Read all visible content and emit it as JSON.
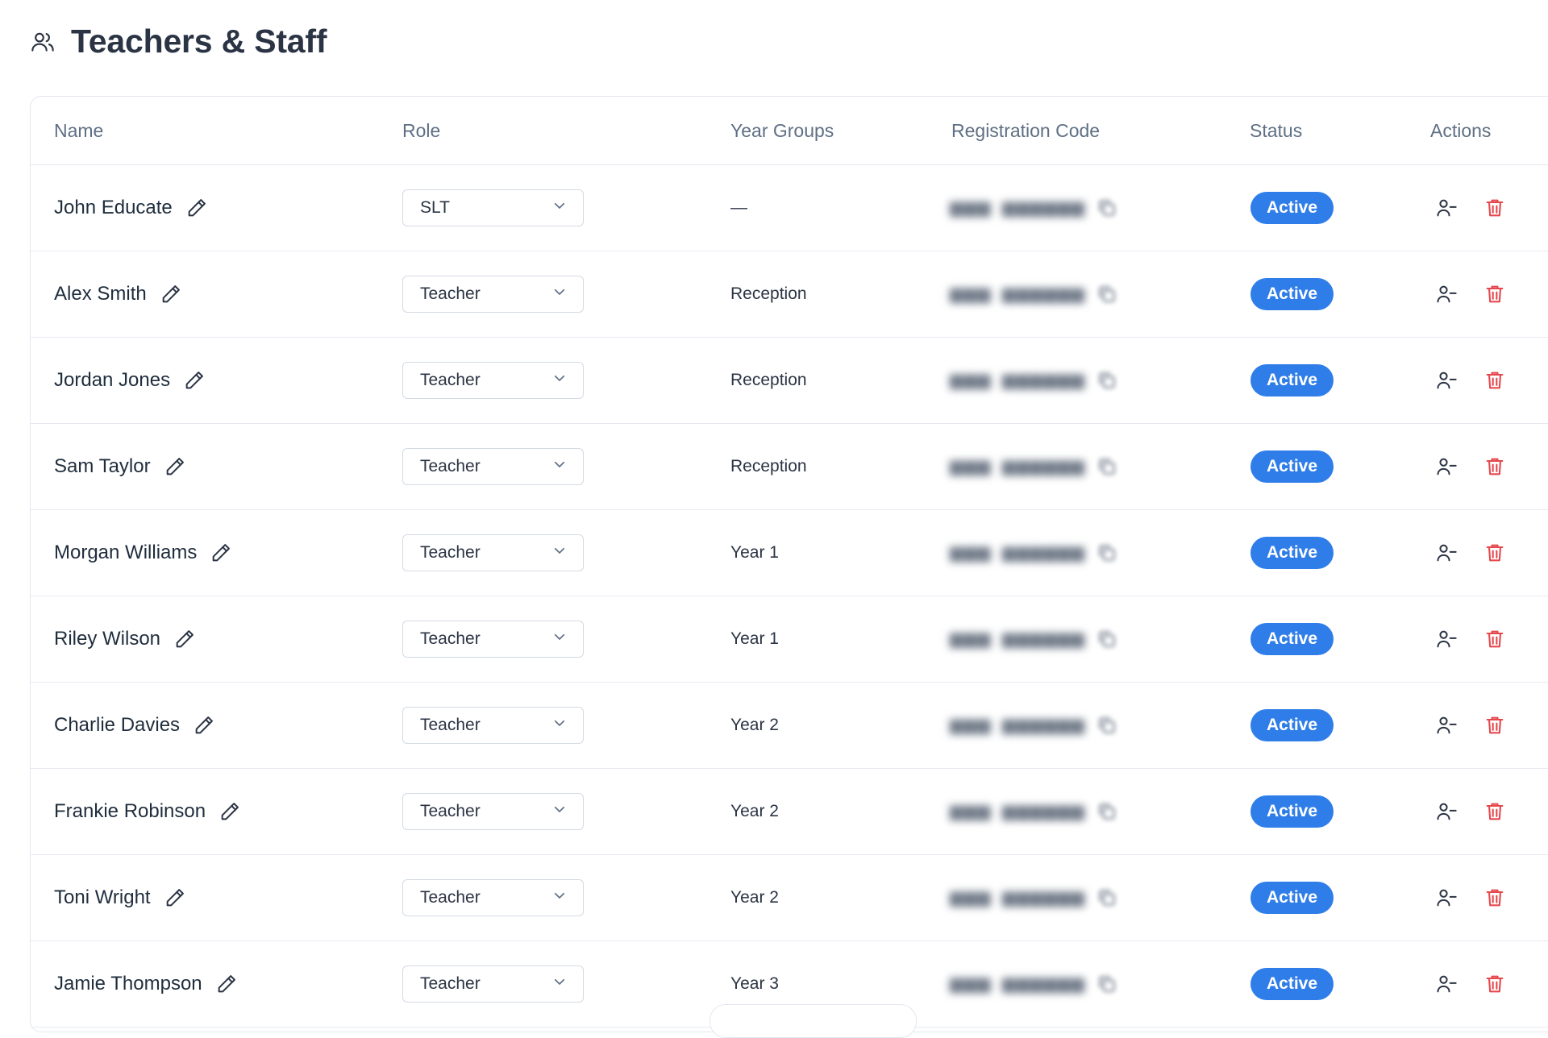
{
  "page": {
    "title": "Teachers & Staff",
    "icon": "users-icon"
  },
  "table": {
    "headers": {
      "name": "Name",
      "role": "Role",
      "year_groups": "Year Groups",
      "registration_code": "Registration Code",
      "status": "Status",
      "actions": "Actions"
    },
    "rows": [
      {
        "name": "John Educate",
        "role": "SLT",
        "year_groups": "—",
        "status": "Active"
      },
      {
        "name": "Alex Smith",
        "role": "Teacher",
        "year_groups": "Reception",
        "status": "Active"
      },
      {
        "name": "Jordan Jones",
        "role": "Teacher",
        "year_groups": "Reception",
        "status": "Active"
      },
      {
        "name": "Sam Taylor",
        "role": "Teacher",
        "year_groups": "Reception",
        "status": "Active"
      },
      {
        "name": "Morgan Williams",
        "role": "Teacher",
        "year_groups": "Year 1",
        "status": "Active"
      },
      {
        "name": "Riley Wilson",
        "role": "Teacher",
        "year_groups": "Year 1",
        "status": "Active"
      },
      {
        "name": "Charlie Davies",
        "role": "Teacher",
        "year_groups": "Year 2",
        "status": "Active"
      },
      {
        "name": "Frankie Robinson",
        "role": "Teacher",
        "year_groups": "Year 2",
        "status": "Active"
      },
      {
        "name": "Toni Wright",
        "role": "Teacher",
        "year_groups": "Year 2",
        "status": "Active"
      },
      {
        "name": "Jamie Thompson",
        "role": "Teacher",
        "year_groups": "Year 3",
        "status": "Active"
      }
    ]
  },
  "colors": {
    "status_active": "#2f7de9",
    "delete_icon": "#e5484d",
    "header_text": "#5f6f84"
  },
  "icons": {
    "edit": "pencil-icon",
    "role_dropdown": "chevron-down-icon",
    "copy_code": "copy-icon",
    "remove_user": "user-minus-icon",
    "delete": "trash-icon"
  }
}
